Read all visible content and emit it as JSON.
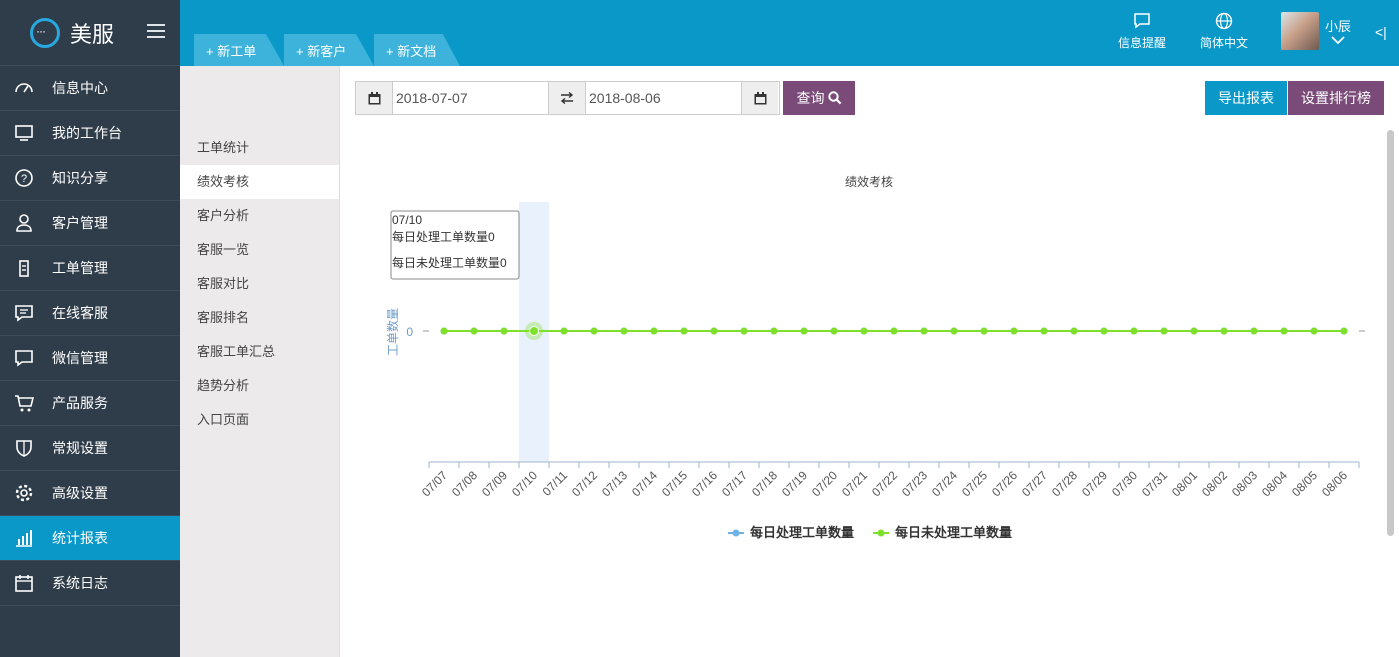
{
  "app": {
    "logo_text": "美服"
  },
  "sidebar": {
    "items": [
      {
        "label": "信息中心",
        "icon": "dashboard-icon",
        "active": false
      },
      {
        "label": "我的工作台",
        "icon": "monitor-icon",
        "active": false
      },
      {
        "label": "知识分享",
        "icon": "question-icon",
        "active": false
      },
      {
        "label": "客户管理",
        "icon": "user-icon",
        "active": false
      },
      {
        "label": "工单管理",
        "icon": "clipboard-icon",
        "active": false
      },
      {
        "label": "在线客服",
        "icon": "chat-lines-icon",
        "active": false
      },
      {
        "label": "微信管理",
        "icon": "chat-bubble-icon",
        "active": false
      },
      {
        "label": "产品服务",
        "icon": "cart-icon",
        "active": false
      },
      {
        "label": "常规设置",
        "icon": "shield-icon",
        "active": false
      },
      {
        "label": "高级设置",
        "icon": "gear-icon",
        "active": false
      },
      {
        "label": "统计报表",
        "icon": "bar-chart-icon",
        "active": true
      },
      {
        "label": "系统日志",
        "icon": "calendar-icon",
        "active": false
      }
    ]
  },
  "topbar": {
    "tabs": [
      {
        "label": "+ 新工单"
      },
      {
        "label": "+ 新客户"
      },
      {
        "label": "+ 新文档"
      }
    ],
    "notifications_label": "信息提醒",
    "language_label": "简体中文",
    "user_name": "小辰",
    "collapse_symbol": "<|"
  },
  "submenu": {
    "items": [
      {
        "label": "工单统计",
        "active": false
      },
      {
        "label": "绩效考核",
        "active": true
      },
      {
        "label": "客户分析",
        "active": false
      },
      {
        "label": "客服一览",
        "active": false
      },
      {
        "label": "客服对比",
        "active": false
      },
      {
        "label": "客服排名",
        "active": false
      },
      {
        "label": "客服工单汇总",
        "active": false
      },
      {
        "label": "趋势分析",
        "active": false
      },
      {
        "label": "入口页面",
        "active": false
      }
    ]
  },
  "filters": {
    "start_date": "2018-07-07",
    "end_date": "2018-08-06",
    "query_label": "查询",
    "export_label": "导出报表",
    "ranking_label": "设置排行榜"
  },
  "colors": {
    "accent": "#0a98c9",
    "purple": "#7a4a78",
    "sidebar": "#2f3d4a",
    "series_processed": "#6db3e8",
    "series_unprocessed": "#7ee02a"
  },
  "tooltip": {
    "date": "07/10",
    "line1": "每日处理工单数量0",
    "line2": "每日未处理工单数量0"
  },
  "chart_data": {
    "type": "line",
    "title": "绩效考核",
    "xlabel": "",
    "ylabel": "工单数量",
    "y_ticks": [
      "0"
    ],
    "categories": [
      "07/07",
      "07/08",
      "07/09",
      "07/10",
      "07/11",
      "07/12",
      "07/13",
      "07/14",
      "07/15",
      "07/16",
      "07/17",
      "07/18",
      "07/19",
      "07/20",
      "07/21",
      "07/22",
      "07/23",
      "07/24",
      "07/25",
      "07/26",
      "07/27",
      "07/28",
      "07/29",
      "07/30",
      "07/31",
      "08/01",
      "08/02",
      "08/03",
      "08/04",
      "08/05",
      "08/06"
    ],
    "series": [
      {
        "name": "每日处理工单数量",
        "color": "#6db3e8",
        "values": [
          0,
          0,
          0,
          0,
          0,
          0,
          0,
          0,
          0,
          0,
          0,
          0,
          0,
          0,
          0,
          0,
          0,
          0,
          0,
          0,
          0,
          0,
          0,
          0,
          0,
          0,
          0,
          0,
          0,
          0,
          0
        ]
      },
      {
        "name": "每日未处理工单数量",
        "color": "#7ee02a",
        "values": [
          0,
          0,
          0,
          0,
          0,
          0,
          0,
          0,
          0,
          0,
          0,
          0,
          0,
          0,
          0,
          0,
          0,
          0,
          0,
          0,
          0,
          0,
          0,
          0,
          0,
          0,
          0,
          0,
          0,
          0,
          0
        ]
      }
    ],
    "highlighted_category": "07/10",
    "legend_position": "bottom",
    "grid": false
  }
}
